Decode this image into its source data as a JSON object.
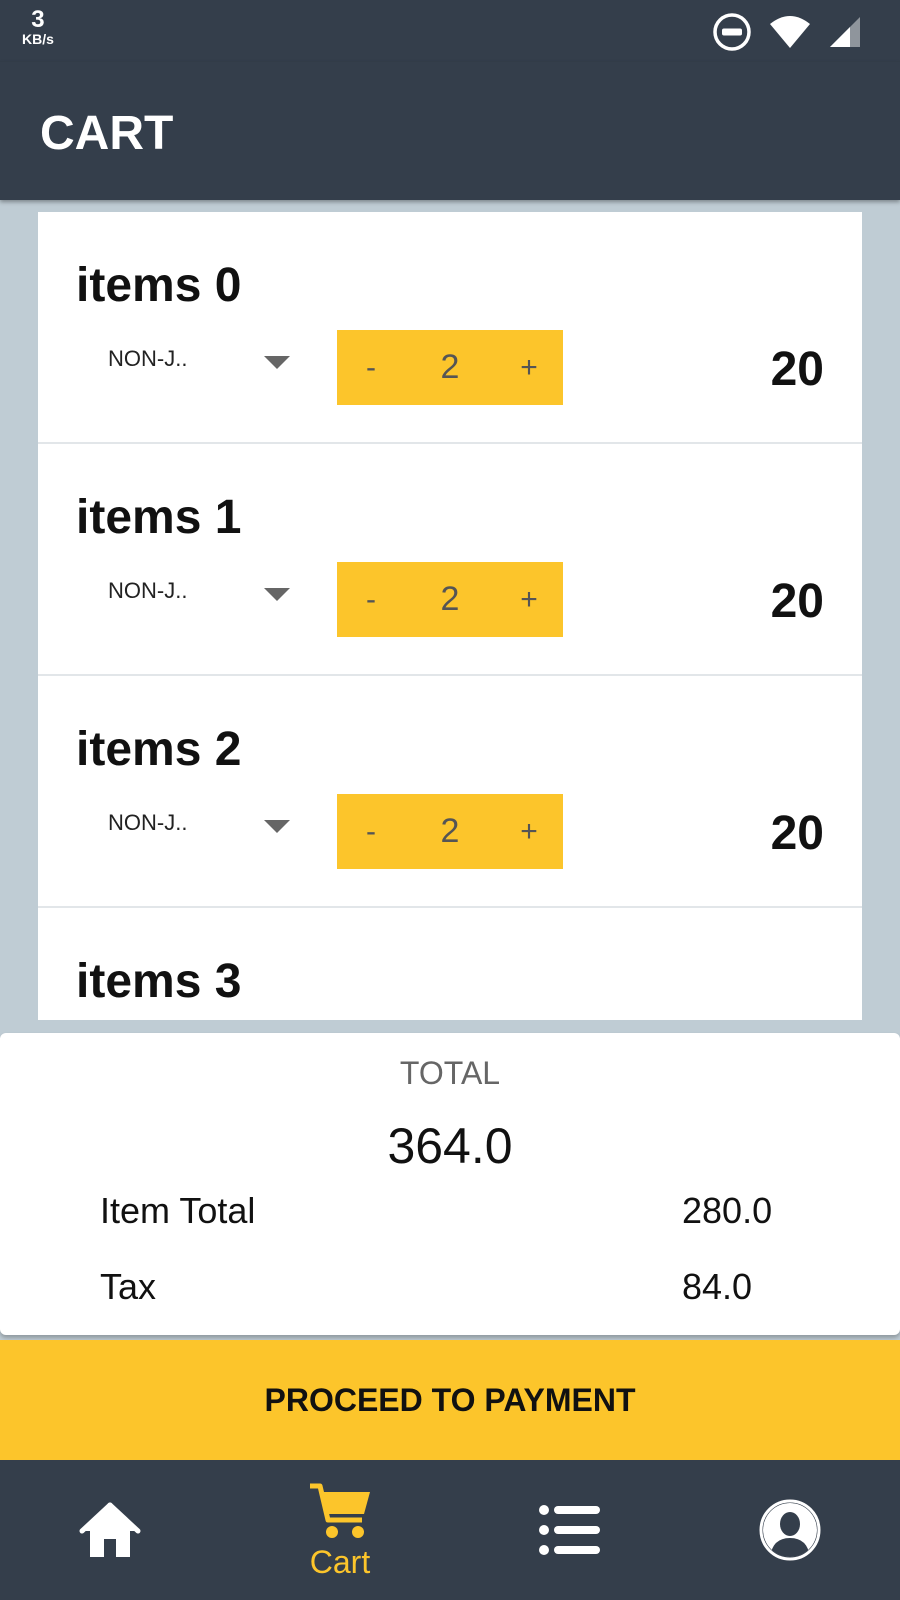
{
  "status_bar": {
    "speed_value": "3",
    "speed_unit": "KB/s",
    "icons": [
      "do-not-disturb-icon",
      "wifi-icon",
      "signal-icon"
    ]
  },
  "app_bar": {
    "title": "CART"
  },
  "cart": {
    "items": [
      {
        "name": "items 0",
        "variant": "NON-J..",
        "quantity": "2",
        "price": "20"
      },
      {
        "name": "items 1",
        "variant": "NON-J..",
        "quantity": "2",
        "price": "20"
      },
      {
        "name": "items 2",
        "variant": "NON-J..",
        "quantity": "2",
        "price": "20"
      },
      {
        "name": "items 3"
      }
    ],
    "stepper": {
      "minus": "-",
      "plus": "+"
    }
  },
  "summary": {
    "total_label": "TOTAL",
    "total_value": "364.0",
    "item_total_label": "Item Total",
    "item_total_value": "280.0",
    "tax_label": "Tax",
    "tax_value": "84.0"
  },
  "pay_button": {
    "label": "PROCEED TO PAYMENT"
  },
  "bottom_nav": {
    "items": [
      {
        "icon": "home-icon"
      },
      {
        "icon": "cart-icon",
        "label": "Cart",
        "active": true
      },
      {
        "icon": "list-icon"
      },
      {
        "icon": "profile-icon"
      }
    ]
  },
  "colors": {
    "primary_dark": "#343e4b",
    "accent": "#fcc52b",
    "background": "#bfccd4"
  }
}
